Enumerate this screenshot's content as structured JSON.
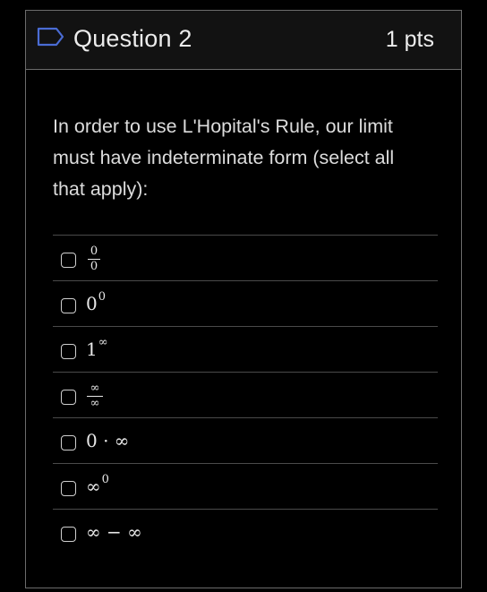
{
  "question": {
    "title": "Question 2",
    "points": "1 pts",
    "prompt": "In order to use L'Hopital's Rule, our limit must have indeterminate form (select all that apply):"
  },
  "answers": [
    {
      "kind": "fraction",
      "numerator": "0",
      "denominator": "0"
    },
    {
      "kind": "power",
      "base": "0",
      "exponent": "0"
    },
    {
      "kind": "power",
      "base": "1",
      "exponent": "∞"
    },
    {
      "kind": "fraction",
      "numerator": "∞",
      "denominator": "∞"
    },
    {
      "kind": "text",
      "text": "0 · ∞"
    },
    {
      "kind": "power",
      "base": "∞",
      "exponent": "0"
    },
    {
      "kind": "text",
      "text": "∞ − ∞"
    }
  ],
  "icons": {
    "flag": "bookmark-flag-icon",
    "checkbox": "checkbox-unchecked-icon"
  },
  "colors": {
    "background": "#000000",
    "header_bg": "#121212",
    "border": "#6c6c6c",
    "flag_accent": "#4a6cd4",
    "text": "#e2e2e2"
  }
}
